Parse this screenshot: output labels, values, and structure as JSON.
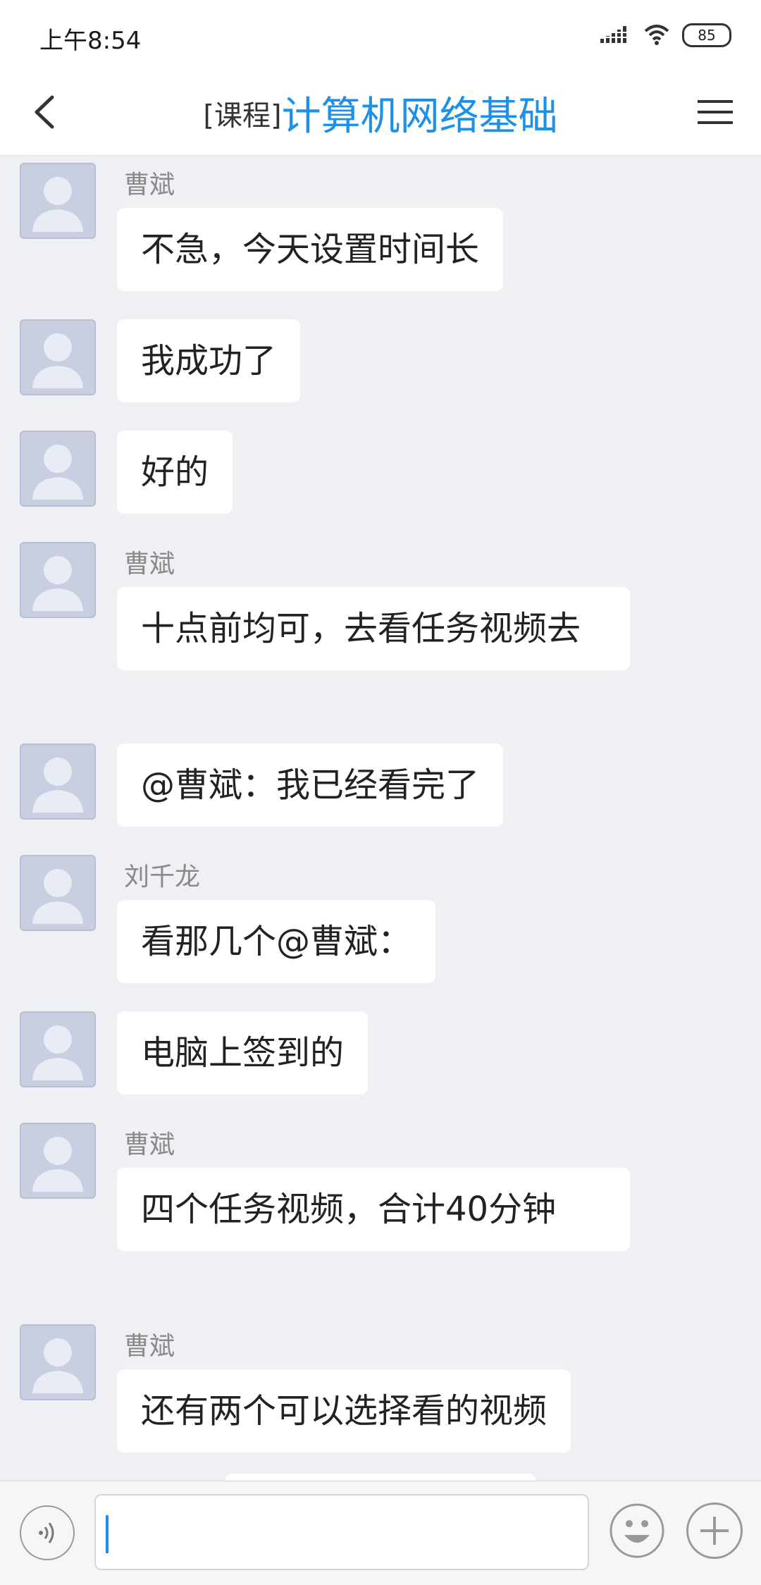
{
  "status_bar": {
    "time": "上午8:54",
    "battery": "85",
    "icons": [
      "signal-icon",
      "wifi-icon",
      "battery-icon"
    ]
  },
  "header": {
    "back_icon": "chevron-left-icon",
    "title_prefix": "[课程]",
    "title": "计算机网络基础",
    "menu_icon": "menu-icon"
  },
  "messages": [
    {
      "sender": "曹斌",
      "text": "不急，今天设置时间长"
    },
    {
      "sender": "",
      "text": "我成功了"
    },
    {
      "sender": "",
      "text": "好的"
    },
    {
      "sender": "曹斌",
      "text": "十点前均可，去看任务视频去"
    },
    {
      "sender": "",
      "text": "@曹斌：我已经看完了"
    },
    {
      "sender": "刘千龙",
      "text": "看那几个@曹斌："
    },
    {
      "sender": "",
      "text": "电脑上签到的"
    },
    {
      "sender": "曹斌",
      "text": "四个任务视频，合计40分钟"
    },
    {
      "sender": "曹斌",
      "text": "还有两个可以选择看的视频"
    }
  ],
  "input_bar": {
    "voice_icon": "voice-icon",
    "input_value": "",
    "emoji_icon": "emoji-icon",
    "plus_icon": "plus-icon"
  },
  "colors": {
    "accent": "#1e90e8",
    "background": "#eef0f3",
    "bubble": "#ffffff",
    "avatar": "#c9cfe0"
  }
}
